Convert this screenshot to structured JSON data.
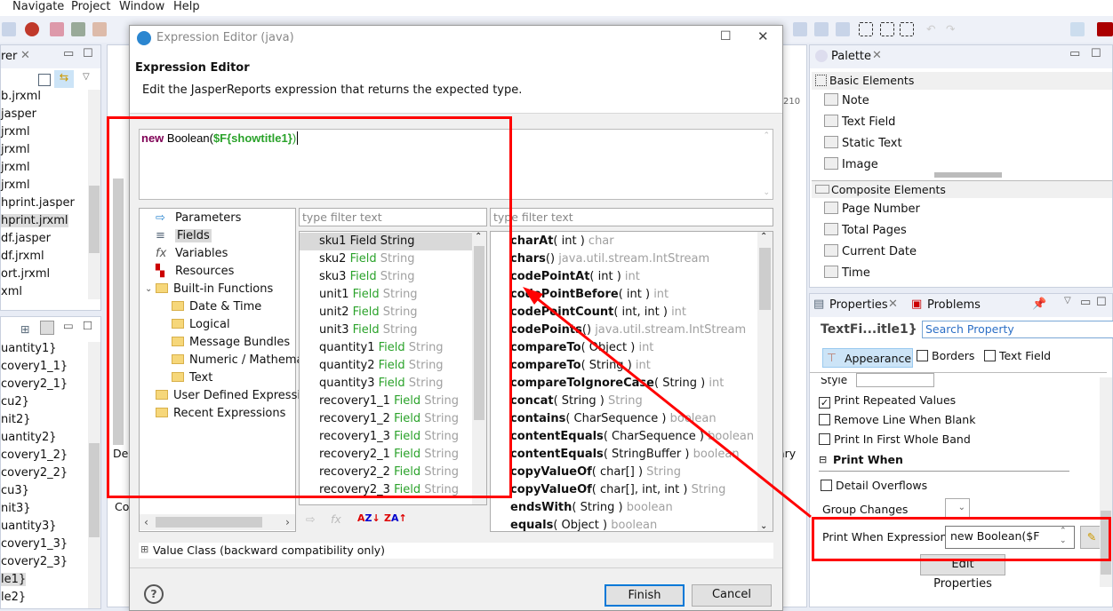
{
  "menu": {
    "items": [
      "Navigate",
      "Project",
      "Window",
      "Help"
    ]
  },
  "left_explorer": {
    "tab": "rer",
    "files": [
      "b.jrxml",
      "jasper",
      "jrxml",
      "jrxml",
      "jrxml",
      "jrxml",
      "hprint.jasper",
      "hprint.jrxml",
      "df.jasper",
      "df.jrxml",
      "ort.jrxml",
      "xml"
    ],
    "selected_index": 7
  },
  "outline": {
    "items": [
      "uantity1}",
      "covery1_1}",
      "covery2_1}",
      "cu2}",
      "nit2}",
      "uantity2}",
      "covery1_2}",
      "covery2_2}",
      "cu3}",
      "nit3}",
      "uantity3}",
      "covery1_3}",
      "covery2_3}",
      "le1}",
      "le2}"
    ],
    "selected_index": 13
  },
  "center_bg": {
    "ruler_num": "210",
    "design_tab": "Des",
    "ary": "ary",
    "co": "Co"
  },
  "dialog": {
    "window_title": "Expression Editor (java)",
    "heading": "Expression Editor",
    "description": "Edit the JasperReports expression that returns the expected type.",
    "expression": {
      "keyword": "new",
      "plain": " Boolean(",
      "field": "$F{showtitle1}",
      "close": ")"
    },
    "tree": [
      {
        "label": "Parameters",
        "icon": "parameters-icon",
        "level": 0
      },
      {
        "label": "Fields",
        "icon": "fields-icon",
        "level": 0,
        "selected": true
      },
      {
        "label": "Variables",
        "icon": "variables-fx-icon",
        "level": 0
      },
      {
        "label": "Resources",
        "icon": "resources-icon",
        "level": 0
      },
      {
        "label": "Built-in Functions",
        "icon": "folder-icon",
        "level": 0,
        "expanded": true
      },
      {
        "label": "Date & Time",
        "icon": "folder-icon",
        "level": 1
      },
      {
        "label": "Logical",
        "icon": "folder-icon",
        "level": 1
      },
      {
        "label": "Message Bundles",
        "icon": "folder-icon",
        "level": 1
      },
      {
        "label": "Numeric / Mathema",
        "icon": "folder-icon",
        "level": 1
      },
      {
        "label": "Text",
        "icon": "folder-icon",
        "level": 1
      },
      {
        "label": "User Defined Expressic",
        "icon": "folder-icon",
        "level": 0
      },
      {
        "label": "Recent Expressions",
        "icon": "folder-icon",
        "level": 0
      }
    ],
    "filter_placeholder": "type filter text",
    "fields": [
      {
        "name": "sku1",
        "kind": "Field",
        "type": "String"
      },
      {
        "name": "sku2",
        "kind": "Field",
        "type": "String"
      },
      {
        "name": "sku3",
        "kind": "Field",
        "type": "String"
      },
      {
        "name": "unit1",
        "kind": "Field",
        "type": "String"
      },
      {
        "name": "unit2",
        "kind": "Field",
        "type": "String"
      },
      {
        "name": "unit3",
        "kind": "Field",
        "type": "String"
      },
      {
        "name": "quantity1",
        "kind": "Field",
        "type": "String"
      },
      {
        "name": "quantity2",
        "kind": "Field",
        "type": "String"
      },
      {
        "name": "quantity3",
        "kind": "Field",
        "type": "String"
      },
      {
        "name": "recovery1_1",
        "kind": "Field",
        "type": "String"
      },
      {
        "name": "recovery1_2",
        "kind": "Field",
        "type": "String"
      },
      {
        "name": "recovery1_3",
        "kind": "Field",
        "type": "String"
      },
      {
        "name": "recovery2_1",
        "kind": "Field",
        "type": "String"
      },
      {
        "name": "recovery2_2",
        "kind": "Field",
        "type": "String"
      },
      {
        "name": "recovery2_3",
        "kind": "Field",
        "type": "String"
      }
    ],
    "methods": [
      {
        "name": "charAt",
        "args": "( int )",
        "ret": "char"
      },
      {
        "name": "chars",
        "args": "()",
        "ret": "java.util.stream.IntStream"
      },
      {
        "name": "codePointAt",
        "args": "( int )",
        "ret": "int"
      },
      {
        "name": "codePointBefore",
        "args": "( int )",
        "ret": "int"
      },
      {
        "name": "codePointCount",
        "args": "( int, int )",
        "ret": "int"
      },
      {
        "name": "codePoints",
        "args": "()",
        "ret": "java.util.stream.IntStream"
      },
      {
        "name": "compareTo",
        "args": "( Object )",
        "ret": "int"
      },
      {
        "name": "compareTo",
        "args": "( String )",
        "ret": "int"
      },
      {
        "name": "compareToIgnoreCase",
        "args": "( String )",
        "ret": "int"
      },
      {
        "name": "concat",
        "args": "( String )",
        "ret": "String"
      },
      {
        "name": "contains",
        "args": "( CharSequence )",
        "ret": "boolean"
      },
      {
        "name": "contentEquals",
        "args": "( CharSequence )",
        "ret": "boolean"
      },
      {
        "name": "contentEquals",
        "args": "( StringBuffer )",
        "ret": "boolean"
      },
      {
        "name": "copyValueOf",
        "args": "( char[] )",
        "ret": "String"
      },
      {
        "name": "copyValueOf",
        "args": "( char[], int, int )",
        "ret": "String"
      },
      {
        "name": "endsWith",
        "args": "( String )",
        "ret": "boolean"
      },
      {
        "name": "equals",
        "args": "( Object )",
        "ret": "boolean"
      }
    ],
    "value_class": "Value Class (backward compatibility only)",
    "finish": "Finish",
    "cancel": "Cancel"
  },
  "palette": {
    "tab": "Palette",
    "basic": "Basic Elements",
    "basic_items": [
      "Note",
      "Text Field",
      "Static Text",
      "Image"
    ],
    "composite": "Composite Elements",
    "composite_items": [
      "Page Number",
      "Total Pages",
      "Current Date",
      "Time"
    ]
  },
  "properties": {
    "tab": "Properties",
    "problems_tab": "Problems",
    "element": "TextFi...itle1}",
    "search_placeholder": "Search Property",
    "subtabs": [
      "Appearance",
      "Borders",
      "Text Field"
    ],
    "style_label": "Style",
    "checks": [
      {
        "label": "Print Repeated Values",
        "checked": true
      },
      {
        "label": "Remove Line When Blank",
        "checked": false
      },
      {
        "label": "Print In First Whole Band",
        "checked": false
      }
    ],
    "print_when": "Print When",
    "detail_overflows": "Detail Overflows",
    "group_changes": "Group Changes",
    "pwe_label": "Print When Expression",
    "pwe_value": "new Boolean($F",
    "edit_properties": "Edit Properties"
  },
  "annotation_color": "#ff0000"
}
